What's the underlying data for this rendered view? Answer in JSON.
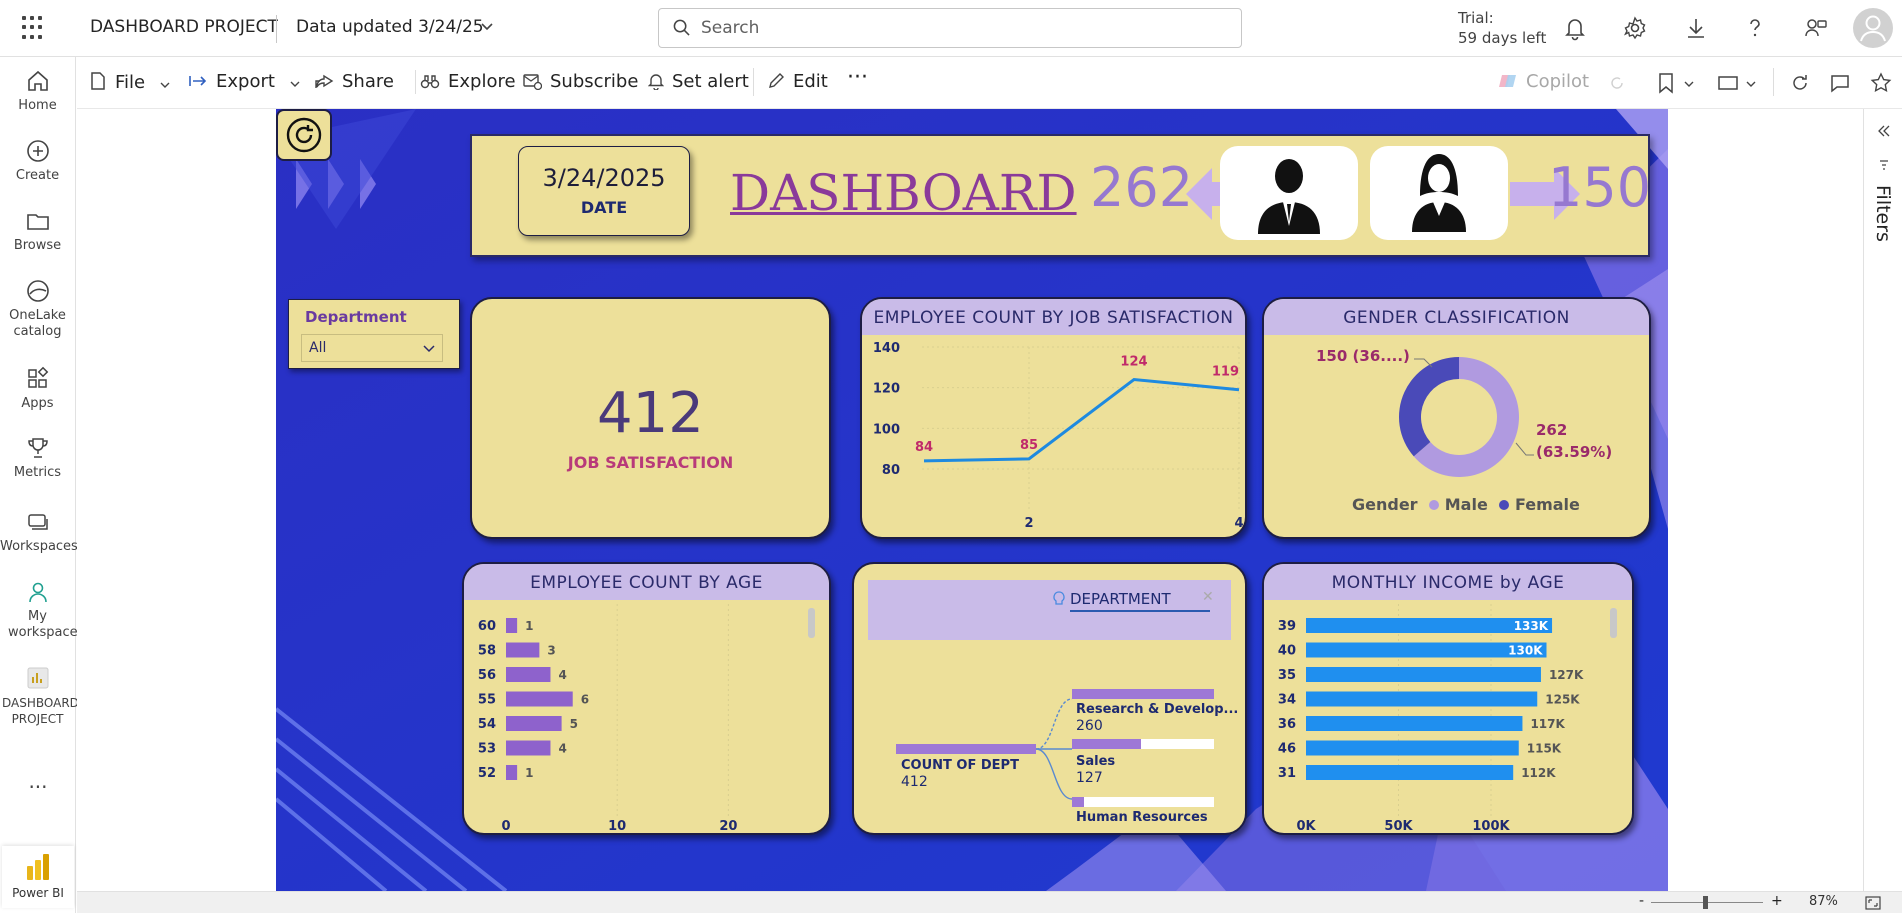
{
  "topbar": {
    "app_title": "DASHBOARD PROJECT",
    "data_updated": "Data updated 3/24/25",
    "search_placeholder": "Search",
    "trial_line1": "Trial:",
    "trial_line2": "59 days left"
  },
  "sidebar": {
    "items": [
      {
        "label": "Home",
        "icon": "home-icon"
      },
      {
        "label": "Create",
        "icon": "plus-circle-icon"
      },
      {
        "label": "Browse",
        "icon": "folder-icon"
      },
      {
        "label": "OneLake catalog",
        "icon": "onelake-icon"
      },
      {
        "label": "Apps",
        "icon": "apps-icon"
      },
      {
        "label": "Metrics",
        "icon": "trophy-icon"
      },
      {
        "label": "Workspaces",
        "icon": "workspaces-icon"
      },
      {
        "label": "My workspace",
        "icon": "person-icon"
      },
      {
        "label": "DASHBOARD PROJECT",
        "icon": "report-icon"
      }
    ],
    "more": "...",
    "brand": "Power BI"
  },
  "cmdbar": {
    "file": "File",
    "export": "Export",
    "share": "Share",
    "explore": "Explore",
    "subscribe": "Subscribe",
    "set_alert": "Set alert",
    "edit": "Edit",
    "more": "···",
    "copilot": "Copilot"
  },
  "filters_label": "Filters",
  "status": {
    "zoom": "87%",
    "minus": "-",
    "plus": "+"
  },
  "report": {
    "header": {
      "date_value": "3/24/2025",
      "date_label": "DATE",
      "title": "DASHBOARD",
      "male_count": "262",
      "female_count": "150"
    },
    "slicer": {
      "title": "Department",
      "value": "All"
    },
    "kpi": {
      "value": "412",
      "label": "JOB SATISFACTION"
    },
    "line_chart": {
      "title": "EMPLOYEE COUNT BY JOB SATISFACTION"
    },
    "donut": {
      "title": "GENDER CLASSIFICATION",
      "label_female": "150 (36....)",
      "label_male_1": "262",
      "label_male_2": "(63.59%)",
      "legend_title": "Gender",
      "legend_male": "Male",
      "legend_female": "Female",
      "color_male": "#b09ae0",
      "color_female": "#4a4ab8"
    },
    "age_chart": {
      "title": "EMPLOYEE COUNT BY AGE"
    },
    "decomp": {
      "field": "DEPARTMENT",
      "root_label": "COUNT OF DEPT",
      "root_value": "412",
      "nodes": [
        {
          "label": "Research & Develop...",
          "value": "260"
        },
        {
          "label": "Sales",
          "value": "127"
        },
        {
          "label": "Human Resources",
          "value": ""
        }
      ]
    },
    "income_chart": {
      "title": "MONTHLY INCOME by AGE"
    }
  },
  "chart_data": [
    {
      "type": "line",
      "title": "EMPLOYEE COUNT BY JOB SATISFACTION",
      "x": [
        1,
        2,
        3,
        4
      ],
      "values": [
        84,
        85,
        124,
        119
      ],
      "xticks": [
        "2",
        "4"
      ],
      "yticks": [
        "80",
        "100",
        "120",
        "140"
      ],
      "ylim": [
        80,
        140
      ],
      "color": "#1e8ae0"
    },
    {
      "type": "pie",
      "title": "GENDER CLASSIFICATION",
      "categories": [
        "Male",
        "Female"
      ],
      "values": [
        262,
        150
      ],
      "percent": [
        63.59,
        36.41
      ]
    },
    {
      "type": "bar",
      "title": "EMPLOYEE COUNT BY AGE",
      "categories": [
        "60",
        "58",
        "56",
        "55",
        "54",
        "53",
        "52"
      ],
      "values": [
        1,
        3,
        4,
        6,
        5,
        4,
        1
      ],
      "xticks": [
        "0",
        "10",
        "20"
      ],
      "xlim": [
        0,
        25
      ],
      "color": "#8e62cc"
    },
    {
      "type": "bar",
      "title": "MONTHLY INCOME by AGE",
      "categories": [
        "39",
        "40",
        "35",
        "34",
        "36",
        "46",
        "31"
      ],
      "values": [
        133,
        130,
        127,
        125,
        117,
        115,
        112
      ],
      "labels": [
        "133K",
        "130K",
        "127K",
        "125K",
        "117K",
        "115K",
        "112K"
      ],
      "xticks": [
        "0K",
        "50K",
        "100K"
      ],
      "xlim": [
        0,
        160
      ],
      "color": "#1f8fef"
    }
  ]
}
